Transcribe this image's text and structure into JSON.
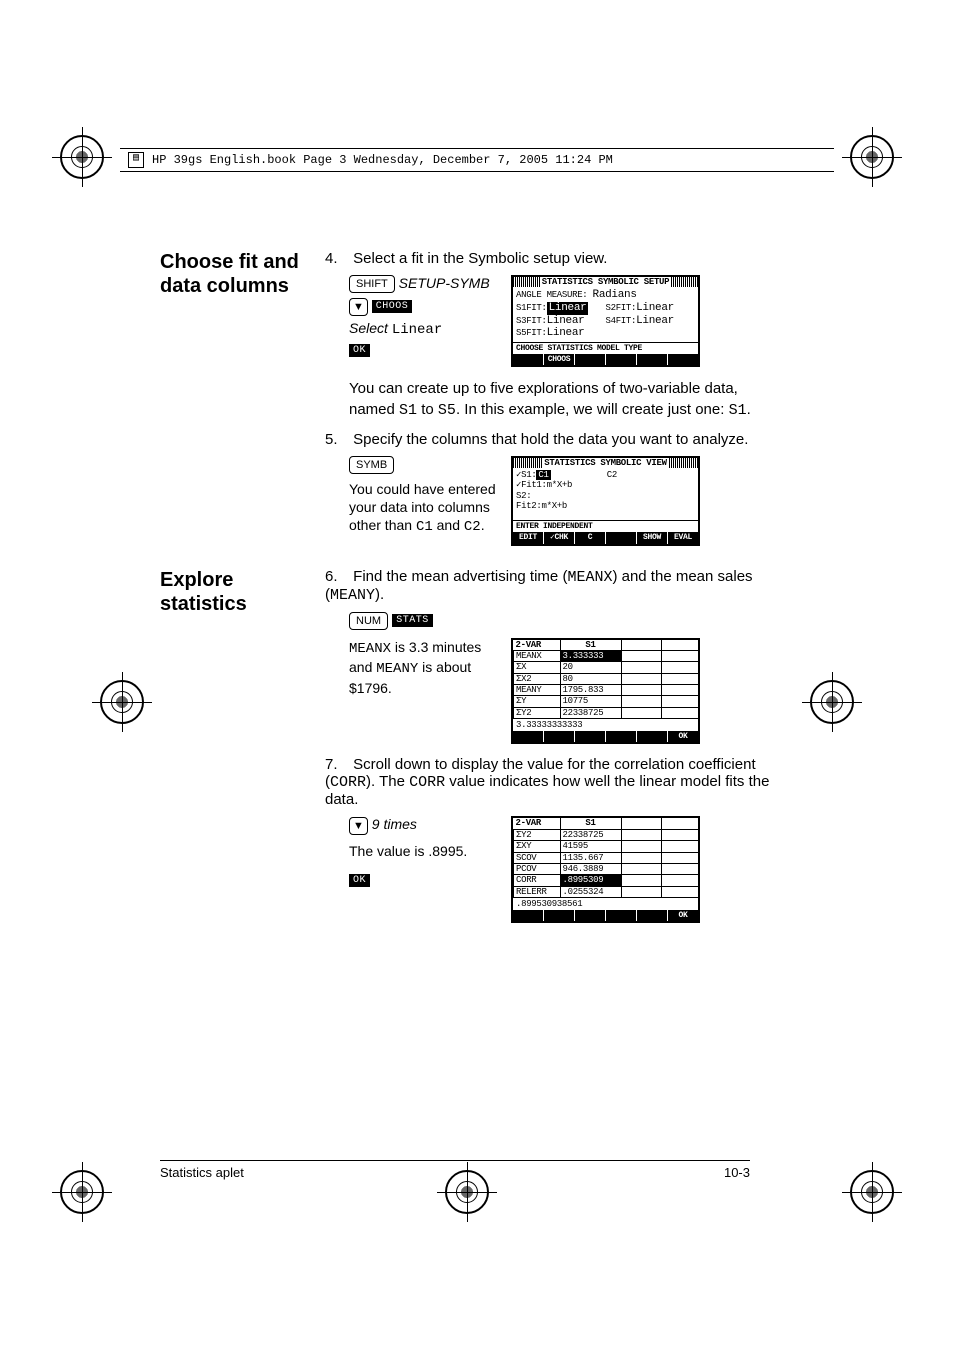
{
  "header": "HP 39gs English.book  Page 3  Wednesday, December 7, 2005  11:24 PM",
  "footer": {
    "left": "Statistics aplet",
    "right": "10-3"
  },
  "sections": {
    "fit": {
      "heading": "Choose fit and data columns",
      "step4": "Select a fit in the Symbolic setup view.",
      "step4_instr_key1": "SHIFT",
      "step4_instr_label": "SETUP-SYMB",
      "step4_instr_soft": "CHOOS",
      "step4_instr_select": "Select",
      "step4_instr_value": "Linear",
      "step4_instr_ok": "OK",
      "after4_p1a": "You can create up to five explorations of two-variable data, named ",
      "after4_s1": "S1",
      "after4_to": " to ",
      "after4_s5": "S5",
      "after4_p1b": ". In this example, we will create just one: ",
      "after4_s1b": "S1",
      "after4_end": ".",
      "step5": "Specify the columns that hold the data you want to analyze.",
      "step5_key": "SYMB",
      "step5_p1": "You could have entered your data into columns other than ",
      "step5_c1": "C1",
      "step5_and": " and ",
      "step5_c2": "C2",
      "step5_end": "."
    },
    "explore": {
      "heading": "Explore statistics",
      "step6a": "Find the mean advertising time (",
      "step6mx": "MEANX",
      "step6b": ") and the mean sales (",
      "step6my": "MEANY",
      "step6c": ").",
      "step6_key": "NUM",
      "step6_soft": "STATS",
      "step6_p1a": "MEANX",
      "step6_p1b": " is 3.3 minutes and ",
      "step6_p1c": "MEANY",
      "step6_p1d": " is about $1796.",
      "step7a": "Scroll down to display the value for the correlation coefficient (",
      "step7corr": "CORR",
      "step7b": "). The ",
      "step7corr2": "CORR",
      "step7c": " value indicates how well the linear model fits the data.",
      "step7_times": "9 times",
      "step7_value": "The value is .8995.",
      "step7_ok": "OK"
    }
  },
  "screens": {
    "setup": {
      "title": "STATISTICS SYMBOLIC SETUP",
      "angle_label": "ANGLE MEASURE:",
      "angle_value": "Radians",
      "s1": "S1FIT:",
      "s1v": "Linear",
      "s2": "S2FIT:",
      "s2v": "Linear",
      "s3": "S3FIT:",
      "s3v": "Linear",
      "s4": "S4FIT:",
      "s4v": "Linear",
      "s5": "S5FIT:",
      "s5v": "Linear",
      "hint": "CHOOSE STATISTICS MODEL TYPE",
      "soft": [
        "",
        "CHOOS",
        "",
        "",
        "",
        ""
      ]
    },
    "symb": {
      "title": "STATISTICS SYMBOLIC VIEW",
      "l1a": "✓S1:",
      "l1b": "C1",
      "l1c": "C2",
      "l2": "✓Fit1:m*X+b",
      "l3": " S2:",
      "l4": " Fit2:m*X+b",
      "hint": "ENTER INDEPENDENT",
      "soft": [
        "EDIT",
        "✓CHK",
        " C ",
        "",
        "SHOW",
        "EVAL"
      ]
    },
    "stats1": {
      "hdr": [
        "2-VAR",
        "S1",
        "",
        ""
      ],
      "rows": [
        [
          "MEANX",
          "3.333333"
        ],
        [
          "ΣX",
          "20"
        ],
        [
          "ΣX2",
          "80"
        ],
        [
          "MEANY",
          "1795.833"
        ],
        [
          "ΣY",
          "10775"
        ],
        [
          "ΣY2",
          "22338725"
        ]
      ],
      "big": "3.33333333333",
      "soft": [
        "",
        "",
        "",
        "",
        "",
        "OK"
      ]
    },
    "stats2": {
      "hdr": [
        "2-VAR",
        "S1",
        "",
        ""
      ],
      "rows": [
        [
          "ΣY2",
          "22338725"
        ],
        [
          "ΣXY",
          "41595"
        ],
        [
          "SCOV",
          "1135.667"
        ],
        [
          "PCOV",
          "946.3889"
        ],
        [
          "CORR",
          ".8995309"
        ],
        [
          "RELERR",
          ".0255324"
        ]
      ],
      "big": ".899530938561",
      "soft": [
        "",
        "",
        "",
        "",
        "",
        "OK"
      ]
    }
  }
}
